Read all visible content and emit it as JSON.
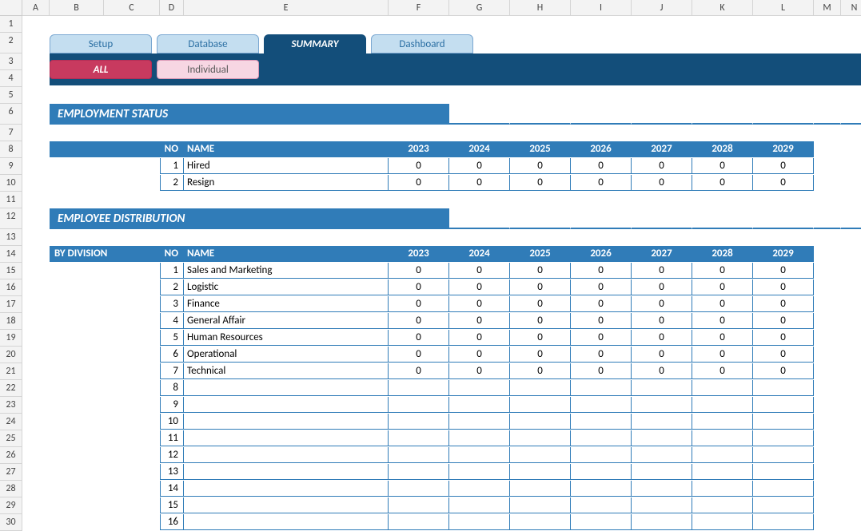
{
  "columns": [
    "A",
    "B",
    "C",
    "D",
    "E",
    "F",
    "G",
    "H",
    "I",
    "J",
    "K",
    "L",
    "M",
    "N"
  ],
  "rowCount": 30,
  "tabs": {
    "setup": "Setup",
    "database": "Database",
    "summary": "SUMMARY",
    "dashboard": "Dashboard"
  },
  "scope": {
    "all": "ALL",
    "individual": "Individual"
  },
  "sections": {
    "empStatus": "EMPLOYMENT STATUS",
    "empDist": "EMPLOYEE DISTRIBUTION"
  },
  "headers": {
    "no": "NO",
    "name": "NAME",
    "byDivision": "BY DIVISION"
  },
  "years": [
    "2023",
    "2024",
    "2025",
    "2026",
    "2027",
    "2028",
    "2029"
  ],
  "statusRows": [
    {
      "no": "1",
      "name": "Hired",
      "vals": [
        "0",
        "0",
        "0",
        "0",
        "0",
        "0",
        "0"
      ]
    },
    {
      "no": "2",
      "name": "Resign",
      "vals": [
        "0",
        "0",
        "0",
        "0",
        "0",
        "0",
        "0"
      ]
    }
  ],
  "divisionRows": [
    {
      "no": "1",
      "name": "Sales and Marketing",
      "vals": [
        "0",
        "0",
        "0",
        "0",
        "0",
        "0",
        "0"
      ]
    },
    {
      "no": "2",
      "name": "Logistic",
      "vals": [
        "0",
        "0",
        "0",
        "0",
        "0",
        "0",
        "0"
      ]
    },
    {
      "no": "3",
      "name": "Finance",
      "vals": [
        "0",
        "0",
        "0",
        "0",
        "0",
        "0",
        "0"
      ]
    },
    {
      "no": "4",
      "name": "General Affair",
      "vals": [
        "0",
        "0",
        "0",
        "0",
        "0",
        "0",
        "0"
      ]
    },
    {
      "no": "5",
      "name": "Human Resources",
      "vals": [
        "0",
        "0",
        "0",
        "0",
        "0",
        "0",
        "0"
      ]
    },
    {
      "no": "6",
      "name": "Operational",
      "vals": [
        "0",
        "0",
        "0",
        "0",
        "0",
        "0",
        "0"
      ]
    },
    {
      "no": "7",
      "name": "Technical",
      "vals": [
        "0",
        "0",
        "0",
        "0",
        "0",
        "0",
        "0"
      ]
    },
    {
      "no": "8",
      "name": "",
      "vals": [
        "",
        "",
        "",
        "",
        "",
        "",
        ""
      ]
    },
    {
      "no": "9",
      "name": "",
      "vals": [
        "",
        "",
        "",
        "",
        "",
        "",
        ""
      ]
    },
    {
      "no": "10",
      "name": "",
      "vals": [
        "",
        "",
        "",
        "",
        "",
        "",
        ""
      ]
    },
    {
      "no": "11",
      "name": "",
      "vals": [
        "",
        "",
        "",
        "",
        "",
        "",
        ""
      ]
    },
    {
      "no": "12",
      "name": "",
      "vals": [
        "",
        "",
        "",
        "",
        "",
        "",
        ""
      ]
    },
    {
      "no": "13",
      "name": "",
      "vals": [
        "",
        "",
        "",
        "",
        "",
        "",
        ""
      ]
    },
    {
      "no": "14",
      "name": "",
      "vals": [
        "",
        "",
        "",
        "",
        "",
        "",
        ""
      ]
    },
    {
      "no": "15",
      "name": "",
      "vals": [
        "",
        "",
        "",
        "",
        "",
        "",
        ""
      ]
    },
    {
      "no": "16",
      "name": "",
      "vals": [
        "",
        "",
        "",
        "",
        "",
        "",
        ""
      ]
    }
  ],
  "chart_data": [
    {
      "type": "table",
      "title": "Employment Status",
      "categories": [
        "2023",
        "2024",
        "2025",
        "2026",
        "2027",
        "2028",
        "2029"
      ],
      "series": [
        {
          "name": "Hired",
          "values": [
            0,
            0,
            0,
            0,
            0,
            0,
            0
          ]
        },
        {
          "name": "Resign",
          "values": [
            0,
            0,
            0,
            0,
            0,
            0,
            0
          ]
        }
      ]
    },
    {
      "type": "table",
      "title": "Employee Distribution by Division",
      "categories": [
        "2023",
        "2024",
        "2025",
        "2026",
        "2027",
        "2028",
        "2029"
      ],
      "series": [
        {
          "name": "Sales and Marketing",
          "values": [
            0,
            0,
            0,
            0,
            0,
            0,
            0
          ]
        },
        {
          "name": "Logistic",
          "values": [
            0,
            0,
            0,
            0,
            0,
            0,
            0
          ]
        },
        {
          "name": "Finance",
          "values": [
            0,
            0,
            0,
            0,
            0,
            0,
            0
          ]
        },
        {
          "name": "General Affair",
          "values": [
            0,
            0,
            0,
            0,
            0,
            0,
            0
          ]
        },
        {
          "name": "Human Resources",
          "values": [
            0,
            0,
            0,
            0,
            0,
            0,
            0
          ]
        },
        {
          "name": "Operational",
          "values": [
            0,
            0,
            0,
            0,
            0,
            0,
            0
          ]
        },
        {
          "name": "Technical",
          "values": [
            0,
            0,
            0,
            0,
            0,
            0,
            0
          ]
        }
      ]
    }
  ]
}
